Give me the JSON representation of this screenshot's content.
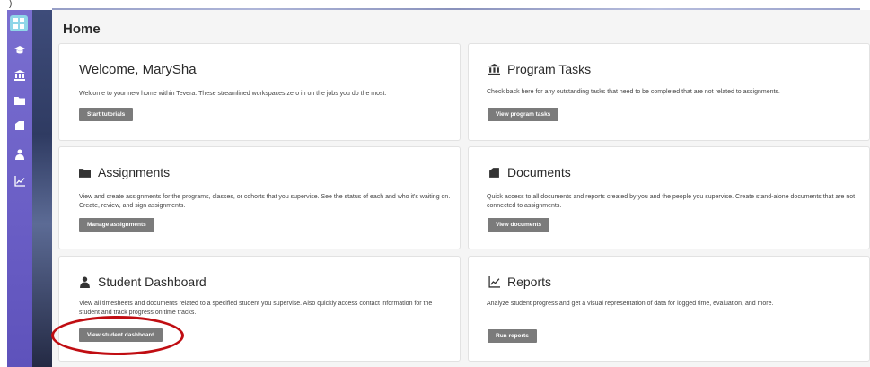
{
  "top_fragment": ")",
  "page": {
    "title": "Home"
  },
  "colors": {
    "sidebar": "#6b5fc6",
    "active_item": "#8fd6e8",
    "button": "#7b7b7b",
    "annotation": "#c00d12"
  },
  "sidebar": {
    "items": [
      {
        "icon": "dashboard-grid-icon",
        "active": true
      },
      {
        "icon": "graduation-cap-icon"
      },
      {
        "icon": "bank-icon"
      },
      {
        "icon": "folder-icon"
      },
      {
        "icon": "document-icon"
      },
      {
        "icon": "student-icon"
      },
      {
        "icon": "chart-line-icon"
      }
    ]
  },
  "cards": {
    "welcome": {
      "title": "Welcome, MarySha",
      "desc": "Welcome to your new home within Tevera. These streamlined workspaces zero in on the jobs you do the most.",
      "button": "Start tutorials"
    },
    "program_tasks": {
      "icon": "bank-icon",
      "title": "Program Tasks",
      "desc": "Check back here for any outstanding tasks that need to be completed that are not related to assignments.",
      "button": "View program tasks"
    },
    "assignments": {
      "icon": "folder-icon",
      "title": "Assignments",
      "desc_line1": "View and create assignments for the programs, classes, or cohorts that you supervise. See the status of each and who it's waiting on.",
      "desc_line2": "Create, review, and sign assignments.",
      "button": "Manage assignments"
    },
    "documents": {
      "icon": "document-icon",
      "title": "Documents",
      "desc_line1": "Quick access to all documents and reports created by you and the people you supervise. Create stand-alone documents that are not",
      "desc_line2": "connected to assignments.",
      "button": "View documents"
    },
    "student_dashboard": {
      "icon": "student-icon",
      "title": "Student Dashboard",
      "desc_line1": "View all timesheets and documents related to a specified student you supervise. Also quickly access contact information for the",
      "desc_line2": "student and track progress on time tracks.",
      "button": "View student dashboard"
    },
    "reports": {
      "icon": "chart-line-icon",
      "title": "Reports",
      "desc": "Analyze student progress and get a visual representation of data for logged time, evaluation, and more.",
      "button": "Run reports"
    }
  }
}
